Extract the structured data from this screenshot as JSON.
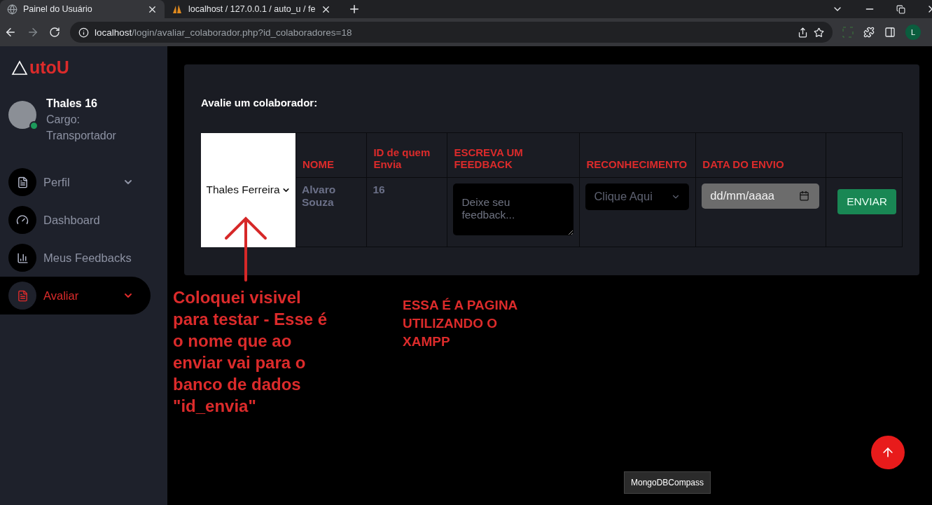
{
  "browser": {
    "tabs": [
      {
        "title": "Painel do Usuário",
        "selected": true
      },
      {
        "title": "localhost / 127.0.0.1 / auto_u / fe",
        "selected": false
      }
    ],
    "address": {
      "host": "localhost",
      "path": "/login/avaliar_colaborador.php?id_colaboradores=18"
    },
    "profile_initial": "L"
  },
  "sidebar": {
    "logo": "utoU",
    "user": {
      "name": "Thales 16",
      "role_label": "Cargo:",
      "role": "Transportador",
      "online": true
    },
    "items": [
      {
        "label": "Perfil",
        "kind": "document",
        "expandable": true,
        "selected": false
      },
      {
        "label": "Dashboard",
        "kind": "gauge",
        "expandable": false,
        "selected": false
      },
      {
        "label": "Meus Feedbacks",
        "kind": "chart",
        "expandable": false,
        "selected": false
      },
      {
        "label": "Avaliar",
        "kind": "document",
        "expandable": true,
        "selected": true
      }
    ]
  },
  "card": {
    "title": "Avalie um colaborador:",
    "select_value": "Thales Ferreira",
    "columns": [
      "NOME",
      "ID de quem Envia",
      "ESCREVA UM FEEDBACK",
      "RECONHECIMENTO",
      "DATA DO ENVIO"
    ],
    "row": {
      "name": "Alvaro Souza",
      "sender_id": "16",
      "feedback_placeholder": "Deixe seu feedback...",
      "recognition": "Clique Aqui",
      "date_placeholder": "dd/mm/aaaa",
      "button": "ENVIAR"
    }
  },
  "annotations": [
    {
      "text": "Coloquei visivel para testar - Esse é o nome que ao enviar vai para o banco de dados \"id_envia\""
    },
    {
      "text": "ESSA É A PAGINA UTILIZANDO O XAMPP"
    }
  ],
  "tooltip": "MongoDBCompass"
}
